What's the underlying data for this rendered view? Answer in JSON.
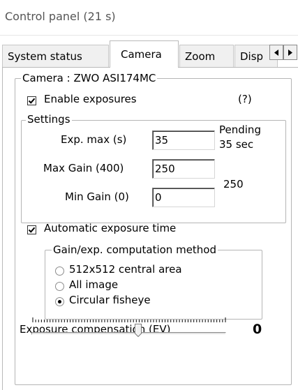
{
  "window": {
    "title": "Control panel (21 s)"
  },
  "tabs": [
    {
      "label": "System status",
      "active": false
    },
    {
      "label": "Camera",
      "active": true
    },
    {
      "label": "Zoom",
      "active": false
    },
    {
      "label": "Disp",
      "active": false
    }
  ],
  "tab_scroll": {
    "left_icon": "arrow-left-icon",
    "right_icon": "arrow-right-icon"
  },
  "camera_group": {
    "legend": "Camera : ZWO ASI174MC",
    "enable_exposures": {
      "label": "Enable exposures",
      "checked": true
    },
    "help": "(?)",
    "settings": {
      "legend": "Settings",
      "exp_max": {
        "label": "Exp. max (s)",
        "value": "35"
      },
      "max_gain": {
        "label": "Max Gain (400)",
        "value": "250"
      },
      "min_gain": {
        "label": "Min Gain (0)",
        "value": "0"
      },
      "pending_line1": "Pending",
      "pending_line2": "35 sec",
      "gain_readout": "250"
    },
    "auto_exposure": {
      "label": "Automatic exposure time",
      "checked": true
    },
    "method": {
      "legend": "Gain/exp. computation method",
      "options": [
        {
          "label": "512x512 central area",
          "selected": false
        },
        {
          "label": "All image",
          "selected": false
        },
        {
          "label": "Circular fisheye",
          "selected": true
        }
      ]
    },
    "exposure_compensation": {
      "label": "Exposure compensation (EV)",
      "value": "0",
      "slider_min": -4,
      "slider_max": 4,
      "slider_position": 0
    }
  }
}
